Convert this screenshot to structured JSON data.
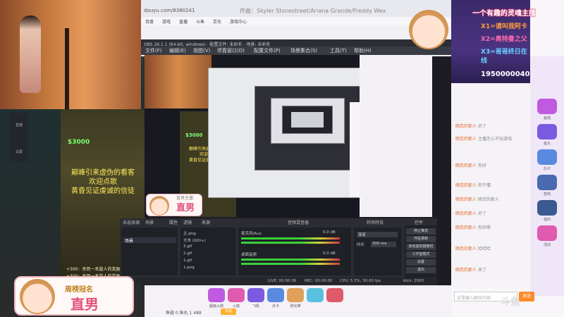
{
  "browser": {
    "url": "douyu.com/8380241",
    "page_title": "作曲：Skyler Stonestreet/Ariana Grande/Freddy Wex",
    "bookmarks": [
      "百度",
      "游戏",
      "直播",
      "斗鱼",
      "京东",
      "游戏中心",
      "斗鱼"
    ]
  },
  "obs": {
    "title": "OBS 26.1.1 (64-bit, windows) - 配置文件: 未命名 - 场景: 未命名",
    "menu": [
      "文件(F)",
      "编辑(E)",
      "视图(V)",
      "停靠窗口(D)",
      "配置文件(P)",
      "场景集合(S)",
      "工具(T)",
      "帮助(H)"
    ],
    "status_label": "未选择源",
    "attr_label": "属性",
    "filter_label": "滤镜",
    "dock_labels": [
      "场景",
      "来源",
      "音频混音器",
      "转场特效",
      "控件"
    ],
    "scenes": [
      "场景"
    ],
    "sources": [
      "主.png",
      "文本 (GDI+)",
      "3.gif",
      "2.gif",
      "1.gif",
      "1.png"
    ],
    "mixer": [
      {
        "name": "麦克风/Aux",
        "db": "0.0 dB"
      },
      {
        "name": "桌面音频",
        "db": "0.0 dB"
      }
    ],
    "transition": {
      "select": "渐变",
      "duration_label": "时长",
      "duration": "300 ms"
    },
    "controls": [
      "停止推流",
      "开始录制",
      "启动虚拟摄像机",
      "工作室模式",
      "设置",
      "退出"
    ],
    "statusbar": [
      "LIVE: 00:00:36",
      "REC: 00:00:00",
      "CPU: 5.3%, 30.00 fps",
      "kb/s: 2500"
    ]
  },
  "game": {
    "money": "$3000",
    "text_lines": [
      "巅峰引来虚伪的看客",
      "欢迎点歌",
      "黄昏见证虔诚的信徒"
    ],
    "chat_lines": [
      "+300：杀死一名敌人的奖励",
      "+300：杀死一名敌人的奖励"
    ]
  },
  "side_nav": [
    "直播",
    "设置"
  ],
  "rank": {
    "title": "一个有趣的灵魂主播",
    "entries": [
      "X1=请叫我阿卡",
      "X2=奥特曼之父",
      "X3=哥哥终日在线"
    ],
    "score": "1950000040"
  },
  "chat": {
    "messages": [
      {
        "user": "暗恋的那人",
        "text": "好了"
      },
      {
        "user": "暗恋的那人",
        "text": "主播怎么不玩游戏"
      },
      {
        "user": "暗恋的那人",
        "text": "你好"
      },
      {
        "user": "暗恋的那人",
        "text": "你不懂"
      },
      {
        "user": "暗恋的那人",
        "text": "暗恋的那人"
      },
      {
        "user": "暗恋的那人",
        "text": "好了"
      },
      {
        "user": "暗恋的那人",
        "text": "你好啊"
      },
      {
        "user": "暗恋的那人",
        "text": "哈哈哈"
      },
      {
        "user": "暗恋的那人",
        "text": "来了"
      }
    ],
    "input_placeholder": "这里输入聊天内容",
    "send_label": "发送"
  },
  "gift_column": [
    "鱼翅",
    "鱼丸",
    "办卡",
    "签到",
    "福利",
    "活动",
    "任务"
  ],
  "gift_bar": {
    "items": [
      "超级火箭",
      "火箭",
      "飞机",
      "办卡",
      "荧光棒",
      "鱼丸",
      "礼物"
    ],
    "wallet": "鱼翅 0  鱼丸 1 488",
    "recharge_label": "充值"
  },
  "badge": {
    "tag": "周榜冠名",
    "name": "直男"
  },
  "badge_small": {
    "tag": "直男主播",
    "name": "直男"
  },
  "watermark": "斗鱼",
  "colors": {
    "accent": "#e2507a",
    "orange": "#ff8a2a",
    "obs_bg": "#2b2d33"
  }
}
